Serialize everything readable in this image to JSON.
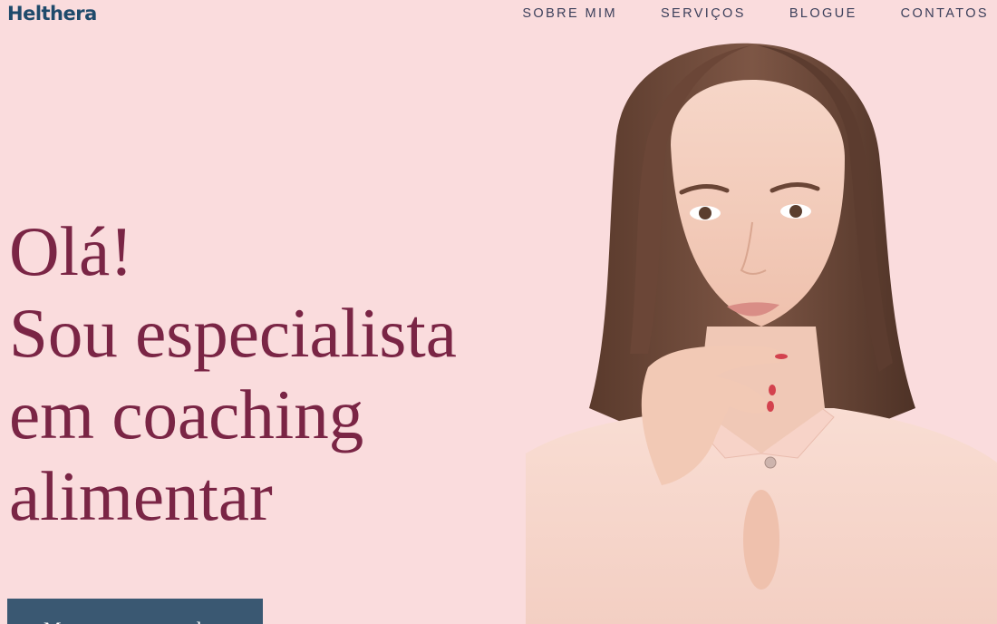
{
  "header": {
    "logo": "Helthera",
    "nav": [
      {
        "label": "SOBRE MIM"
      },
      {
        "label": "SERVIÇOS"
      },
      {
        "label": "BLOGUE"
      },
      {
        "label": "CONTATOS"
      }
    ]
  },
  "hero": {
    "lines": [
      "Olá!",
      "Sou especialista",
      "em coaching",
      "alimentar"
    ],
    "cta_label": "Marque uma consulta"
  },
  "colors": {
    "background": "#fadcdd",
    "heading": "#7a2545",
    "logo": "#1f4a6b",
    "button": "#3a5872"
  }
}
